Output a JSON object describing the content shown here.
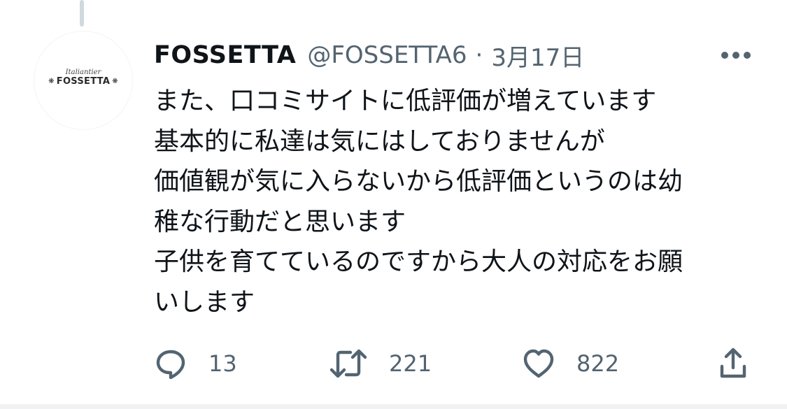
{
  "tweet": {
    "avatar": {
      "logo_script": "Italiantier",
      "logo_text": "FOSSETTA"
    },
    "display_name": "FOSSETTA",
    "handle": "@FOSSETTA6",
    "separator": "·",
    "date": "3月17日",
    "text_lines": [
      "また、口コミサイトに低評価が増えています",
      "基本的に私達は気にはしておりませんが",
      "価値観が気に入らないから低評価というのは幼",
      "稚な行動だと思います",
      "子供を育てているのですから大人の対応をお願",
      "いします"
    ],
    "actions": {
      "reply_count": "13",
      "retweet_count": "221",
      "like_count": "822"
    }
  },
  "colors": {
    "text": "#0f1419",
    "secondary": "#536471",
    "thread_line": "#cfd9de"
  },
  "icons": [
    "more-icon",
    "reply-icon",
    "retweet-icon",
    "like-icon",
    "share-icon"
  ]
}
